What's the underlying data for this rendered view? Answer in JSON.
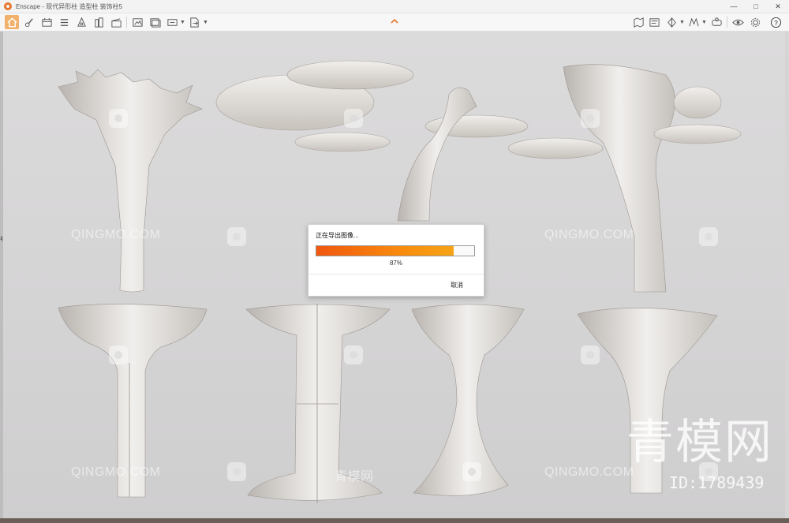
{
  "window": {
    "app_name": "Enscape",
    "title": "Enscape - 现代异形柱 造型柱 装饰柱5",
    "controls": [
      "minimize-icon",
      "maximize-icon",
      "close-icon"
    ]
  },
  "toolbar": {
    "left_icons": [
      "home-icon",
      "walk-icon",
      "calendar-icon",
      "list-icon",
      "file-up-icon",
      "building-icon",
      "clapper-icon",
      "export-image-icon",
      "export-batch-icon",
      "export-panorama-icon",
      "export-file-icon"
    ],
    "right_icons": [
      "map-icon",
      "video-icon",
      "compass-icon",
      "material-icon",
      "vr-icon",
      "eye-icon",
      "gear-icon",
      "help-icon"
    ],
    "accent_color": "#f2b16a"
  },
  "left_edge_char": "非",
  "watermarks": {
    "latin": "QINGMO.COM",
    "cn_small": "青模网",
    "brand": "青模网",
    "id": "ID:1789439"
  },
  "export_dialog": {
    "title": "正在导出图像...",
    "progress": 0.87,
    "progress_label": "87%",
    "cancel_label": "取消",
    "progress_colors": [
      "#f0570f",
      "#f6a417"
    ]
  }
}
